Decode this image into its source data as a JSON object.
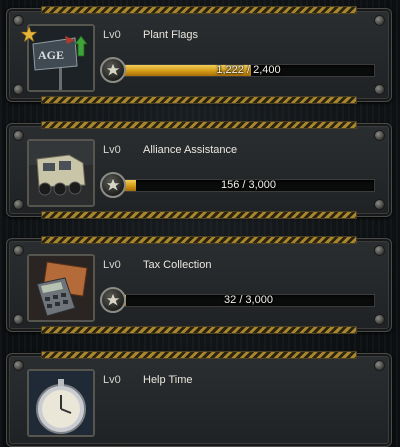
{
  "items": [
    {
      "level": "Lv0",
      "title": "Plant Flags",
      "progress_text": "1,222 / 2,400",
      "progress": 0.509,
      "icon": "flag-icon",
      "starred": true
    },
    {
      "level": "Lv0",
      "title": "Alliance Assistance",
      "progress_text": "156 / 3,000",
      "progress": 0.052,
      "icon": "armored-truck-icon",
      "starred": false
    },
    {
      "level": "Lv0",
      "title": "Tax Collection",
      "progress_text": "32 / 3,000",
      "progress": 0.011,
      "icon": "calculator-icon",
      "starred": false
    },
    {
      "level": "Lv0",
      "title": "Help Time",
      "icon": "pocket-watch-icon",
      "starred": false
    }
  ],
  "colors": {
    "progress_fill": "#e2b132",
    "hazard_stripe": "#a8862e"
  }
}
